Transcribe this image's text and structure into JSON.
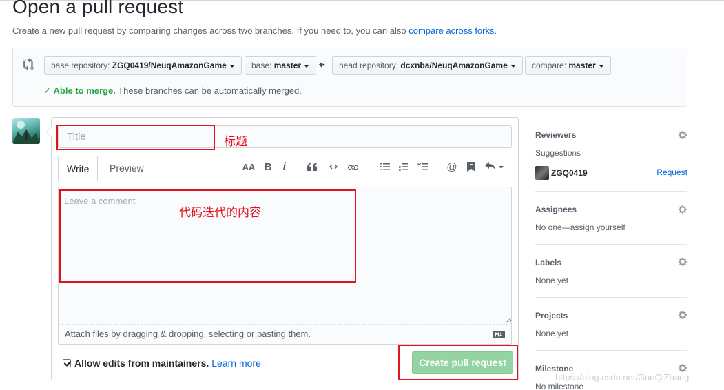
{
  "page": {
    "title": "Open a pull request",
    "subtitle": "Create a new pull request by comparing changes across two branches. If you need to, you can also",
    "subtitle_link": "compare across forks",
    "subtitle_end": "."
  },
  "compare": {
    "base_repo_label": "base repository:",
    "base_repo_value": "ZGQ0419/NeuqAmazonGame",
    "base_label": "base:",
    "base_value": "master",
    "head_repo_label": "head repository:",
    "head_repo_value": "dcxnba/NeuqAmazonGame",
    "compare_label": "compare:",
    "compare_value": "master",
    "merge_status": "Able to merge.",
    "merge_text": "These branches can be automatically merged."
  },
  "form": {
    "title_placeholder": "Title",
    "tab_write": "Write",
    "tab_preview": "Preview",
    "comment_placeholder": "Leave a comment",
    "attach_text": "Attach files by dragging & dropping, selecting or pasting them.",
    "allow_edits": "Allow edits from maintainers.",
    "learn_more": "Learn more",
    "create_button": "Create pull request",
    "toolbar": {
      "header": "AA",
      "bold": "B",
      "italic": "i"
    }
  },
  "annotations": {
    "title_note": "标题",
    "content_note": "代码迭代的内容",
    "color": "#e0141c"
  },
  "sidebar": {
    "reviewers_heading": "Reviewers",
    "suggestions_label": "Suggestions",
    "suggested_user": "ZGQ0419",
    "request_link": "Request",
    "assignees_heading": "Assignees",
    "assignees_text": "No one—assign yourself",
    "labels_heading": "Labels",
    "labels_text": "None yet",
    "projects_heading": "Projects",
    "projects_text": "None yet",
    "milestone_heading": "Milestone",
    "milestone_text": "No milestone"
  },
  "watermark": "https://blog.csdn.net/GuoQiZhang",
  "colors": {
    "link": "#0366d6",
    "success": "#28a745",
    "create_button": "#94d3a2"
  }
}
